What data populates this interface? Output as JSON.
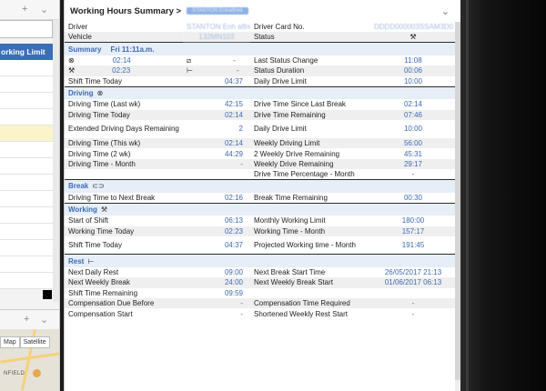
{
  "left": {
    "column_header": "orking Limit",
    "map_tabs": [
      "Map",
      "Satellite"
    ],
    "map_place": "NFIELD"
  },
  "panel": {
    "title": "Working Hours Summary >",
    "title_chip": "STANTON Enhalfred",
    "header_rows": [
      {
        "l1": "Driver",
        "v1": "STANTON Enh alfred",
        "l2": "Driver Card No.",
        "v2": "DDDD000003SSAM3D0"
      },
      {
        "l1": "Vehicle",
        "v1": "132MN103",
        "l2": "Status",
        "v2_icon": "hammer-pick-icon"
      }
    ],
    "summary": {
      "title": "Summary",
      "subtitle": "Fri 11:11a.m.",
      "rows": [
        {
          "icon1": "steering-wheel-icon",
          "v1": "02:14",
          "icon2": "slash-square-icon",
          "v2": "-",
          "l3": "Last Status Change",
          "v3": "11:08"
        },
        {
          "icon1": "hammer-pick-icon",
          "v1": "02:23",
          "icon2": "bed-icon",
          "v2": "-",
          "l3": "Status Duration",
          "v3": "00:06"
        },
        {
          "l1": "Shift Time Today",
          "v1": "04:37",
          "l3": "Daily Drive Limit",
          "v3": "10:00"
        }
      ]
    },
    "driving": {
      "title": "Driving",
      "rows": [
        {
          "l1": "Driving Time (Last wk)",
          "v1": "42:15",
          "l2": "Drive Time Since Last Break",
          "v2": "02:14"
        },
        {
          "l1": "Driving Time Today",
          "v1": "02:14",
          "l2": "Drive Time Remaining",
          "v2": "07:46"
        },
        {
          "l1": "Extended Driving Days Remaining",
          "v1": "2",
          "l2": "Daily Drive Limit",
          "v2": "10:00",
          "two": true
        },
        {
          "l1": "Driving Time (This wk)",
          "v1": "02:14",
          "l2": "Weekly Driving Limit",
          "v2": "56:00"
        },
        {
          "l1": "Driving Time (2 wk)",
          "v1": "44:29",
          "l2": "2 Weekly Drive Remaining",
          "v2": "45:31"
        },
        {
          "l1": "Driving Time - Month",
          "v1": "-",
          "l2": "Weekly Drive Remaining",
          "v2": "29:17"
        },
        {
          "l1": "",
          "v1": "",
          "l2": "Drive Time Percentage - Month",
          "v2": "-"
        }
      ]
    },
    "break": {
      "title": "Break",
      "rows": [
        {
          "l1": "Driving Time to Next Break",
          "v1": "02:16",
          "l2": "Break Time Remaining",
          "v2": "00:30"
        }
      ]
    },
    "working": {
      "title": "Working",
      "rows": [
        {
          "l1": "Start of Shift",
          "v1": "06:13",
          "l2": "Monthly Working Limit",
          "v2": "180:00"
        },
        {
          "l1": "Working Time Today",
          "v1": "02:23",
          "l2": "Working Time - Month",
          "v2": "157:17"
        },
        {
          "l1": "Shift Time Today",
          "v1": "04:37",
          "l2": "Projected Working time - Month",
          "v2": "191:45",
          "two": true
        }
      ]
    },
    "rest": {
      "title": "Rest",
      "rows": [
        {
          "l1": "Next Daily Rest",
          "v1": "09:00",
          "l2": "Next Break Start Time",
          "v2": "26/05/2017 21:13"
        },
        {
          "l1": "Next Weekly Break",
          "v1": "24:00",
          "l2": "Next Weekly Break Start",
          "v2": "01/06/2017 06:13"
        },
        {
          "l1": "Shift Time Remaining",
          "v1": "09:59",
          "l2": "",
          "v2": ""
        },
        {
          "l1": "Compensation Due Before",
          "v1": "-",
          "l2": "Compensation Time Required",
          "v2": "-"
        },
        {
          "l1": "Compensation Start",
          "v1": "-",
          "l2": "Shortened Weekly Rest Start",
          "v2": "-"
        }
      ]
    }
  }
}
